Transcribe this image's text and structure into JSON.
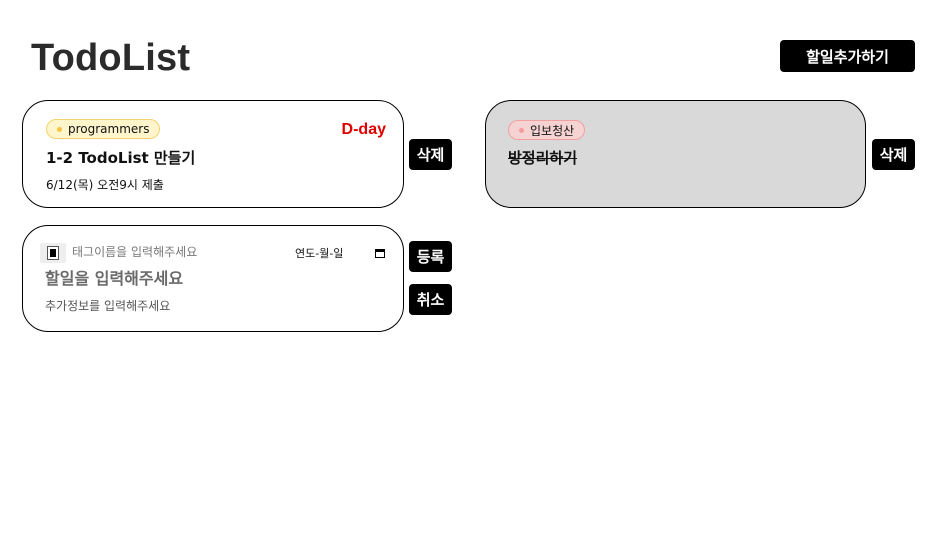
{
  "header": {
    "title": "TodoList",
    "add_button_label": "할일추가하기"
  },
  "todos": [
    {
      "tag": "programmers",
      "tag_color": "#f5c542",
      "title": "1-2 TodoList 만들기",
      "info": "6/12(목) 오전9시 제출",
      "dday": "D-day",
      "delete_label": "삭제",
      "completed": false
    },
    {
      "tag": "입보청산",
      "tag_color": "#f29c9c",
      "title": "방정리하기",
      "delete_label": "삭제",
      "completed": true
    }
  ],
  "new_todo": {
    "tag_placeholder": "태그이름을 입력해주세요",
    "date_placeholder": "연도-월-일",
    "title_placeholder": "할일을 입력해주세요",
    "info_placeholder": "추가정보를 입력해주세요",
    "register_label": "등록",
    "cancel_label": "취소"
  },
  "colors": {
    "dday": "#e00000",
    "completed_bg": "#d9d9d9",
    "button_bg": "#000000"
  }
}
